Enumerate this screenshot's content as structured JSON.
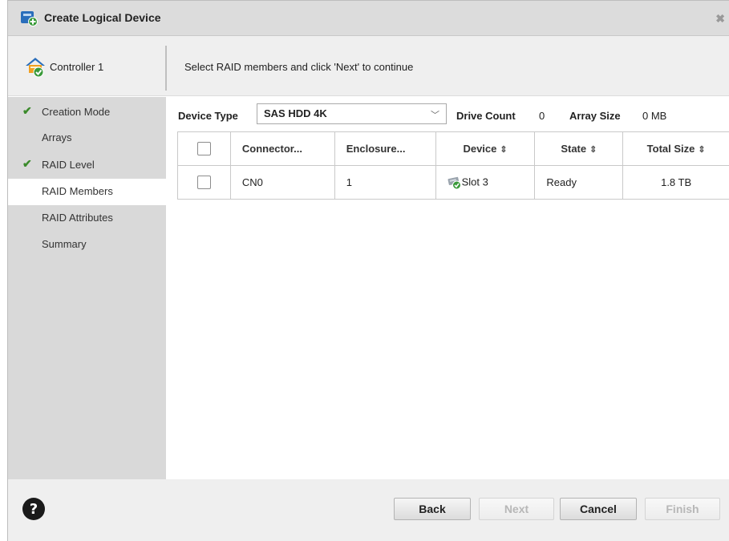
{
  "dialog": {
    "title": "Create Logical Device",
    "close_symbol": "✖"
  },
  "header": {
    "controller_label": "Controller 1",
    "instructions": "Select RAID members and click 'Next' to continue"
  },
  "sidebar": {
    "items": [
      {
        "label": "Creation Mode",
        "checked": true
      },
      {
        "label": "Arrays",
        "checked": false
      },
      {
        "label": "RAID Level",
        "checked": true
      },
      {
        "label": "RAID Members",
        "checked": false,
        "active": true
      },
      {
        "label": "RAID Attributes",
        "checked": false
      },
      {
        "label": "Summary",
        "checked": false
      }
    ]
  },
  "toolbar": {
    "device_type_label": "Device Type",
    "device_type_value": "SAS HDD 4K",
    "drive_count_label": "Drive Count",
    "drive_count_value": "0",
    "array_size_label": "Array Size",
    "array_size_value": "0 MB"
  },
  "table": {
    "columns": [
      "Connector...",
      "Enclosure...",
      "Device",
      "State",
      "Total Size"
    ],
    "rows": [
      {
        "connector": "CN0",
        "enclosure": "1",
        "device": "Slot 3",
        "state": "Ready",
        "total_size": "1.8 TB"
      }
    ]
  },
  "footer": {
    "back_label": "Back",
    "next_label": "Next",
    "cancel_label": "Cancel",
    "finish_label": "Finish"
  },
  "colors": {
    "check_green": "#3a8a2a",
    "help_icon": "#1a1a1a",
    "accent_blue": "#2a6ebb"
  }
}
